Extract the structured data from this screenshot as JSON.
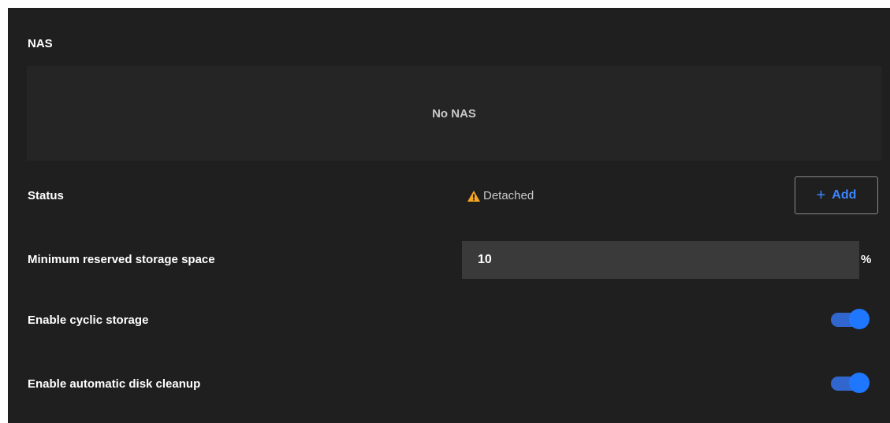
{
  "nas": {
    "title": "NAS",
    "empty_text": "No NAS"
  },
  "status": {
    "label": "Status",
    "value": "Detached",
    "icon": "warning-icon",
    "icon_color": "#f5a623"
  },
  "add_button": {
    "icon": "plus-icon",
    "icon_glyph": "+",
    "label": "Add",
    "color": "#3c86ff"
  },
  "reserved_storage": {
    "label": "Minimum reserved storage space",
    "value": "10",
    "unit": "%"
  },
  "cyclic_storage": {
    "label": "Enable cyclic storage",
    "enabled": true
  },
  "auto_cleanup": {
    "label": "Enable automatic disk cleanup",
    "enabled": true
  },
  "colors": {
    "background": "#1f1f1f",
    "toggle_on": "#1f77ff"
  }
}
